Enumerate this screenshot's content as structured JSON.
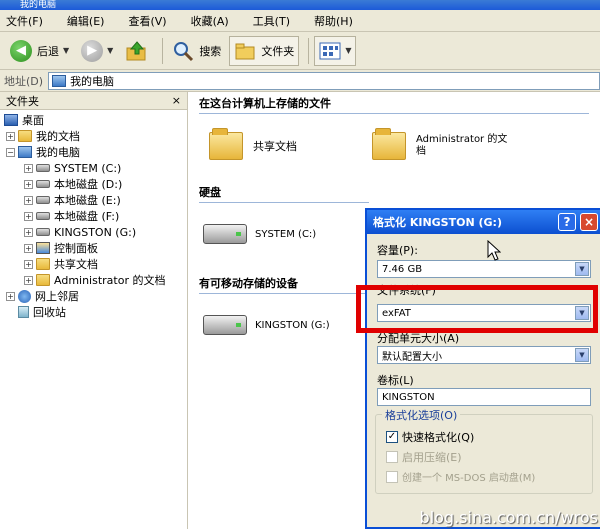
{
  "window": {
    "title": "我的电脑"
  },
  "menu": [
    "文件(F)",
    "编辑(E)",
    "查看(V)",
    "收藏(A)",
    "工具(T)",
    "帮助(H)"
  ],
  "toolbar": {
    "back": "后退",
    "search": "搜索",
    "folders": "文件夹"
  },
  "address": {
    "label": "地址(D)",
    "value": "我的电脑"
  },
  "folders": {
    "header": "文件夹",
    "close": "×",
    "tree": [
      {
        "label": "桌面",
        "icon": "desktop-icon"
      },
      {
        "label": "我的文档",
        "icon": "folder-icon"
      },
      {
        "label": "我的电脑",
        "icon": "computer-icon"
      },
      {
        "label": "SYSTEM (C:)",
        "icon": "drive-icon"
      },
      {
        "label": "本地磁盘 (D:)",
        "icon": "drive-icon"
      },
      {
        "label": "本地磁盘 (E:)",
        "icon": "drive-icon"
      },
      {
        "label": "本地磁盘 (F:)",
        "icon": "drive-icon"
      },
      {
        "label": "KINGSTON (G:)",
        "icon": "drive-icon"
      },
      {
        "label": "控制面板",
        "icon": "control-panel-icon"
      },
      {
        "label": "共享文档",
        "icon": "folder-icon"
      },
      {
        "label": "Administrator 的文档",
        "icon": "folder-icon"
      },
      {
        "label": "网上邻居",
        "icon": "network-icon"
      },
      {
        "label": "回收站",
        "icon": "recycle-bin-icon"
      }
    ]
  },
  "content": {
    "section_files": "在这台计算机上存储的文件",
    "shared_docs": "共享文档",
    "admin_docs_line1": "Administrator 的文",
    "admin_docs_line2": "档",
    "section_hdd": "硬盘",
    "system_drive": "SYSTEM (C:)",
    "section_removable": "有可移动存储的设备",
    "kingston_drive": "KINGSTON (G:)"
  },
  "dialog": {
    "title": "格式化 KINGSTON (G:)",
    "help": "?",
    "close": "×",
    "capacity_label": "容量(P):",
    "capacity_value": "7.46 GB",
    "filesystem_label": "文件系统(F)",
    "filesystem_value": "exFAT",
    "allocation_label": "分配单元大小(A)",
    "allocation_value": "默认配置大小",
    "volume_label": "卷标(L)",
    "volume_value": "KINGSTON",
    "options_title": "格式化选项(O)",
    "quick_format": "快速格式化(Q)",
    "quick_format_checked": true,
    "compress": "启用压缩(E)",
    "boot_disk": "创建一个 MS-DOS 启动盘(M)"
  },
  "watermark": "blog.sina.com.cn/wros",
  "colors": {
    "highlight": "#e00000",
    "title_blue": "#0c4fd0"
  }
}
